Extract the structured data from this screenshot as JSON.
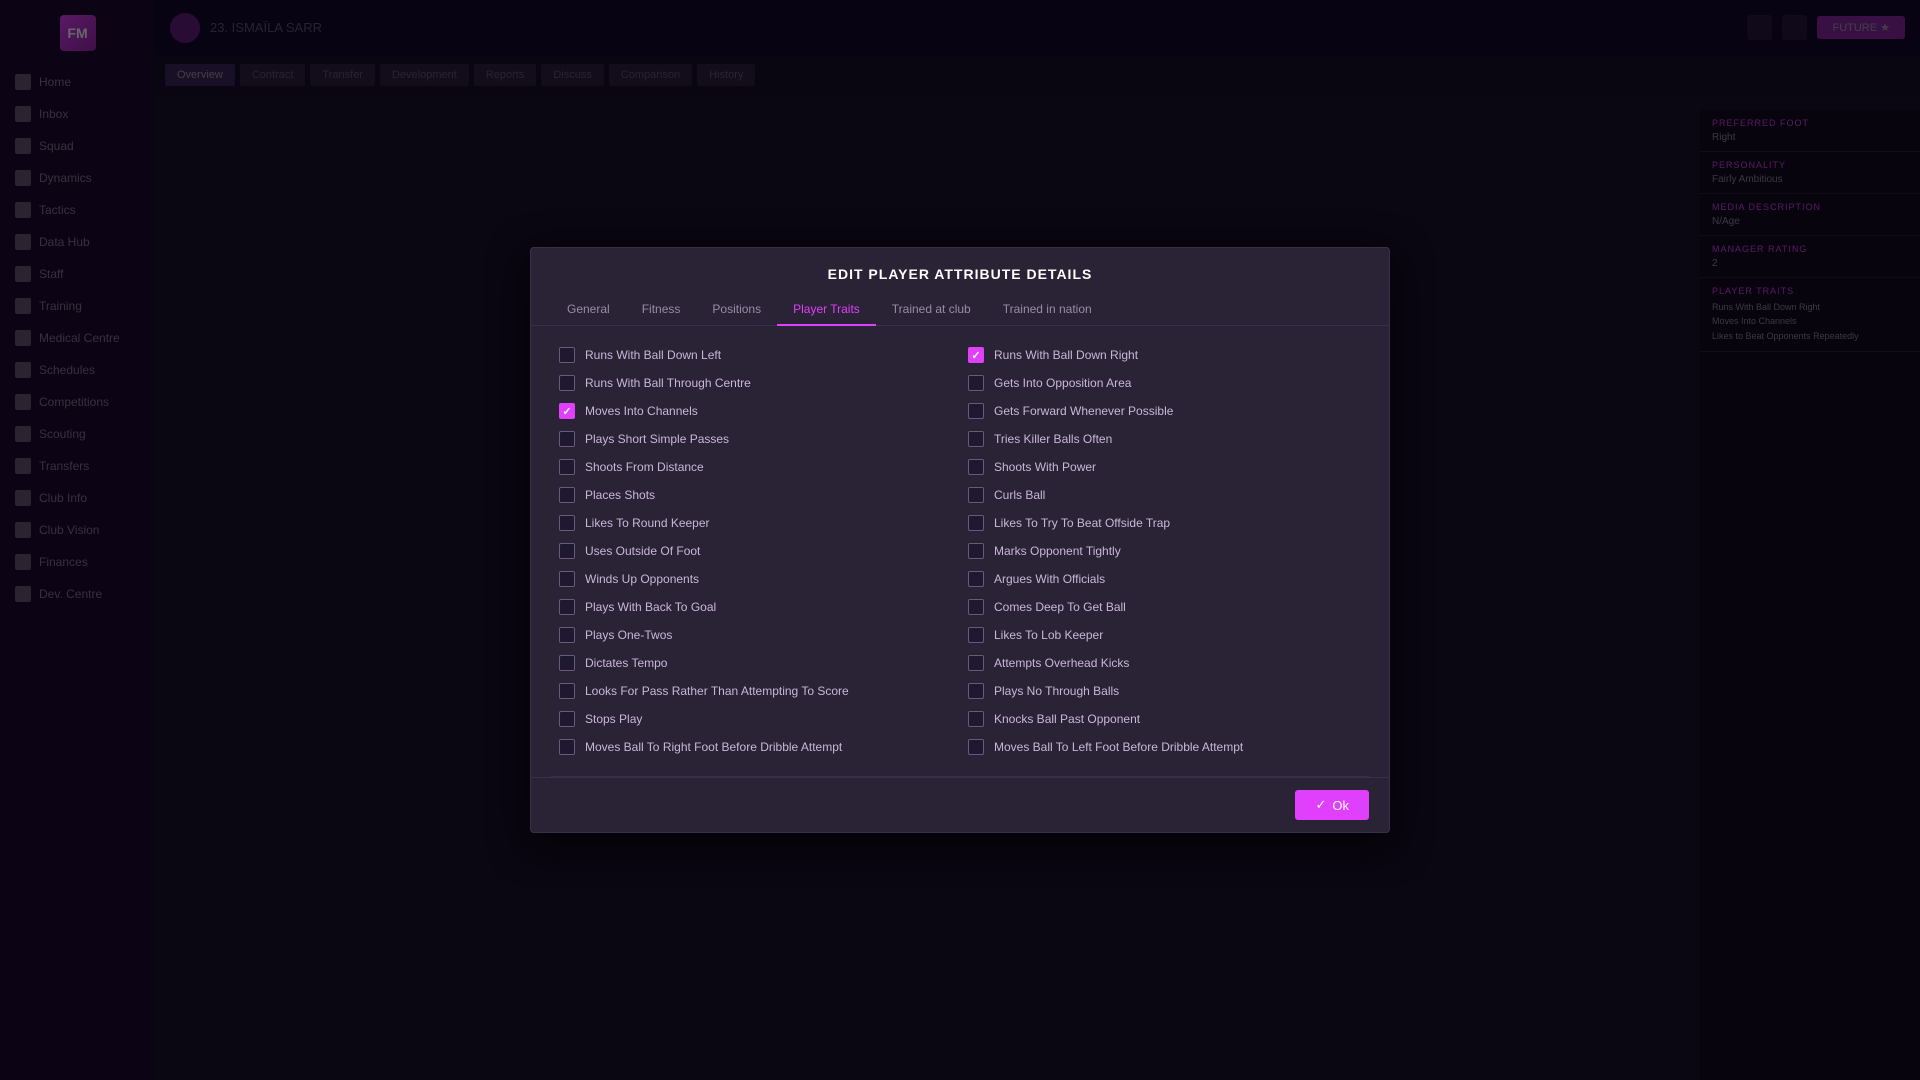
{
  "dialog": {
    "title": "EDIT PLAYER ATTRIBUTE DETAILS",
    "tabs": [
      {
        "label": "General",
        "active": false
      },
      {
        "label": "Fitness",
        "active": false
      },
      {
        "label": "Positions",
        "active": false
      },
      {
        "label": "Player Traits",
        "active": true
      },
      {
        "label": "Trained at club",
        "active": false
      },
      {
        "label": "Trained in nation",
        "active": false
      }
    ],
    "ok_button": "Ok"
  },
  "traits_left": [
    {
      "label": "Runs With Ball Down Left",
      "checked": false
    },
    {
      "label": "Runs With Ball Through Centre",
      "checked": false
    },
    {
      "label": "Moves Into Channels",
      "checked": true
    },
    {
      "label": "Plays Short Simple Passes",
      "checked": false
    },
    {
      "label": "Shoots From Distance",
      "checked": false
    },
    {
      "label": "Places Shots",
      "checked": false
    },
    {
      "label": "Likes To Round Keeper",
      "checked": false
    },
    {
      "label": "Uses Outside Of Foot",
      "checked": false
    },
    {
      "label": "Winds Up Opponents",
      "checked": false
    },
    {
      "label": "Plays With Back To Goal",
      "checked": false
    },
    {
      "label": "Plays One-Twos",
      "checked": false
    },
    {
      "label": "Dictates Tempo",
      "checked": false
    },
    {
      "label": "Looks For Pass Rather Than Attempting To Score",
      "checked": false
    },
    {
      "label": "Stops Play",
      "checked": false
    },
    {
      "label": "Moves Ball To Right Foot Before Dribble Attempt",
      "checked": false
    }
  ],
  "traits_right": [
    {
      "label": "Runs With Ball Down Right",
      "checked": true
    },
    {
      "label": "Gets Into Opposition Area",
      "checked": false
    },
    {
      "label": "Gets Forward Whenever Possible",
      "checked": false
    },
    {
      "label": "Tries Killer Balls Often",
      "checked": false
    },
    {
      "label": "Shoots With Power",
      "checked": false
    },
    {
      "label": "Curls Ball",
      "checked": false
    },
    {
      "label": "Likes To Try To Beat Offside Trap",
      "checked": false
    },
    {
      "label": "Marks Opponent Tightly",
      "checked": false
    },
    {
      "label": "Argues With Officials",
      "checked": false
    },
    {
      "label": "Comes Deep To Get Ball",
      "checked": false
    },
    {
      "label": "Likes To Lob Keeper",
      "checked": false
    },
    {
      "label": "Attempts Overhead Kicks",
      "checked": false
    },
    {
      "label": "Plays No Through Balls",
      "checked": false
    },
    {
      "label": "Knocks Ball Past Opponent",
      "checked": false
    },
    {
      "label": "Moves Ball To Left Foot Before Dribble Attempt",
      "checked": false
    }
  ],
  "sidebar": {
    "items": [
      {
        "label": "Home"
      },
      {
        "label": "Inbox"
      },
      {
        "label": "Squad"
      },
      {
        "label": "Dynamics"
      },
      {
        "label": "Tactics"
      },
      {
        "label": "Data Hub"
      },
      {
        "label": "Staff"
      },
      {
        "label": "Training"
      },
      {
        "label": "Medical Centre"
      },
      {
        "label": "Schedules"
      },
      {
        "label": "Competitions"
      },
      {
        "label": "Scouting"
      },
      {
        "label": "Transfers"
      },
      {
        "label": "Club Info"
      },
      {
        "label": "Club Vision"
      },
      {
        "label": "Finances"
      },
      {
        "label": "Dev. Centre"
      }
    ]
  },
  "right_panel": {
    "preferred_foot": {
      "label": "PREFERRED FOOT",
      "value": "Right"
    },
    "personality": {
      "label": "PERSONALITY",
      "value": "Fairly Ambitious"
    },
    "media_desc": {
      "label": "MEDIA DESCRIPTION",
      "value": "N/Age"
    },
    "manager_rating": {
      "label": "MANAGER RATING",
      "value": "2"
    },
    "player_traits": {
      "label": "PLAYER TRAITS",
      "values": [
        "Runs With Ball Down Right",
        "Moves Into Channels",
        "Likes to Beat Opponents Repeatedly"
      ]
    }
  }
}
